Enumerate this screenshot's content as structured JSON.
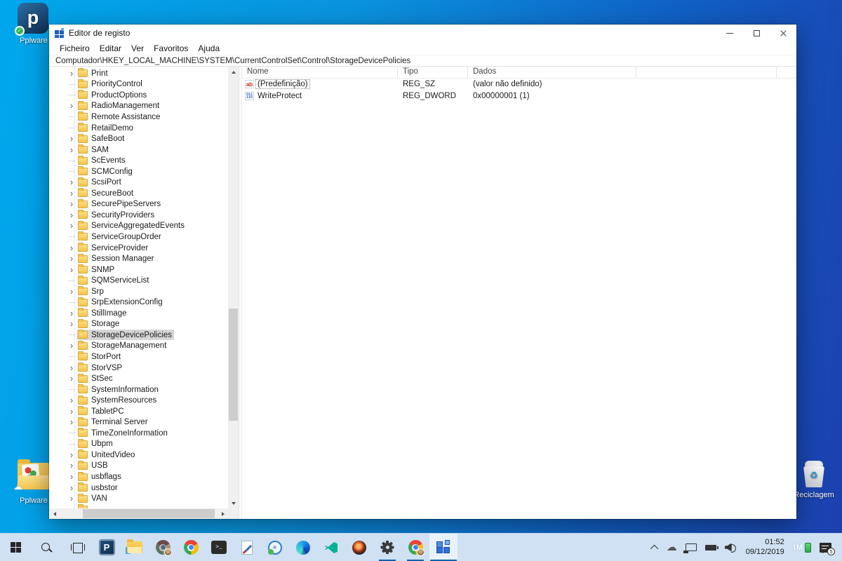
{
  "desktop": {
    "icons": {
      "pplware_app": {
        "label": "Pplware"
      },
      "pplware_folder": {
        "label": "Pplware"
      },
      "recycle_bin": {
        "label": "Reciclagem"
      }
    }
  },
  "window": {
    "title": "Editor de registo",
    "menu": [
      "Ficheiro",
      "Editar",
      "Ver",
      "Favoritos",
      "Ajuda"
    ],
    "address": "Computador\\HKEY_LOCAL_MACHINE\\SYSTEM\\CurrentControlSet\\Control\\StorageDevicePolicies"
  },
  "tree": {
    "items": [
      {
        "label": "Print",
        "exp": true
      },
      {
        "label": "PriorityControl",
        "exp": false
      },
      {
        "label": "ProductOptions",
        "exp": false
      },
      {
        "label": "RadioManagement",
        "exp": true
      },
      {
        "label": "Remote Assistance",
        "exp": false
      },
      {
        "label": "RetailDemo",
        "exp": false
      },
      {
        "label": "SafeBoot",
        "exp": true
      },
      {
        "label": "SAM",
        "exp": true
      },
      {
        "label": "ScEvents",
        "exp": false
      },
      {
        "label": "SCMConfig",
        "exp": false
      },
      {
        "label": "ScsiPort",
        "exp": true
      },
      {
        "label": "SecureBoot",
        "exp": true
      },
      {
        "label": "SecurePipeServers",
        "exp": true
      },
      {
        "label": "SecurityProviders",
        "exp": true
      },
      {
        "label": "ServiceAggregatedEvents",
        "exp": true
      },
      {
        "label": "ServiceGroupOrder",
        "exp": false
      },
      {
        "label": "ServiceProvider",
        "exp": true
      },
      {
        "label": "Session Manager",
        "exp": true
      },
      {
        "label": "SNMP",
        "exp": true
      },
      {
        "label": "SQMServiceList",
        "exp": false
      },
      {
        "label": "Srp",
        "exp": true
      },
      {
        "label": "SrpExtensionConfig",
        "exp": false
      },
      {
        "label": "StillImage",
        "exp": true
      },
      {
        "label": "Storage",
        "exp": true
      },
      {
        "label": "StorageDevicePolicies",
        "exp": false,
        "selected": true
      },
      {
        "label": "StorageManagement",
        "exp": true
      },
      {
        "label": "StorPort",
        "exp": false
      },
      {
        "label": "StorVSP",
        "exp": true
      },
      {
        "label": "StSec",
        "exp": true
      },
      {
        "label": "SystemInformation",
        "exp": false
      },
      {
        "label": "SystemResources",
        "exp": true
      },
      {
        "label": "TabletPC",
        "exp": true
      },
      {
        "label": "Terminal Server",
        "exp": true
      },
      {
        "label": "TimeZoneInformation",
        "exp": false
      },
      {
        "label": "Ubpm",
        "exp": false
      },
      {
        "label": "UnitedVideo",
        "exp": true
      },
      {
        "label": "USB",
        "exp": true
      },
      {
        "label": "usbflags",
        "exp": true
      },
      {
        "label": "usbstor",
        "exp": true
      },
      {
        "label": "VAN",
        "exp": true
      },
      {
        "label": "",
        "exp": false
      }
    ]
  },
  "values": {
    "columns": [
      "Nome",
      "Tipo",
      "Dados"
    ],
    "rows": [
      {
        "icon": "string",
        "name": "(Predefinição)",
        "type": "REG_SZ",
        "data": "(valor não definido)",
        "focused": true
      },
      {
        "icon": "dword",
        "name": "WriteProtect",
        "type": "REG_DWORD",
        "data": "0x00000001 (1)",
        "focused": false
      }
    ]
  },
  "taskbar": {
    "icons": [
      "start",
      "search",
      "task-view",
      "pplware",
      "file-explorer",
      "chrome-profile",
      "chrome",
      "terminal",
      "text-editor",
      "disc-app",
      "edge",
      "vscode",
      "dark-orb",
      "settings",
      "chrome-profile-2",
      "registry-editor"
    ],
    "tray": {
      "time": "01:52",
      "date": "09/12/2019",
      "notifications_badge": "5",
      "accent_color": "#0063b1"
    }
  }
}
